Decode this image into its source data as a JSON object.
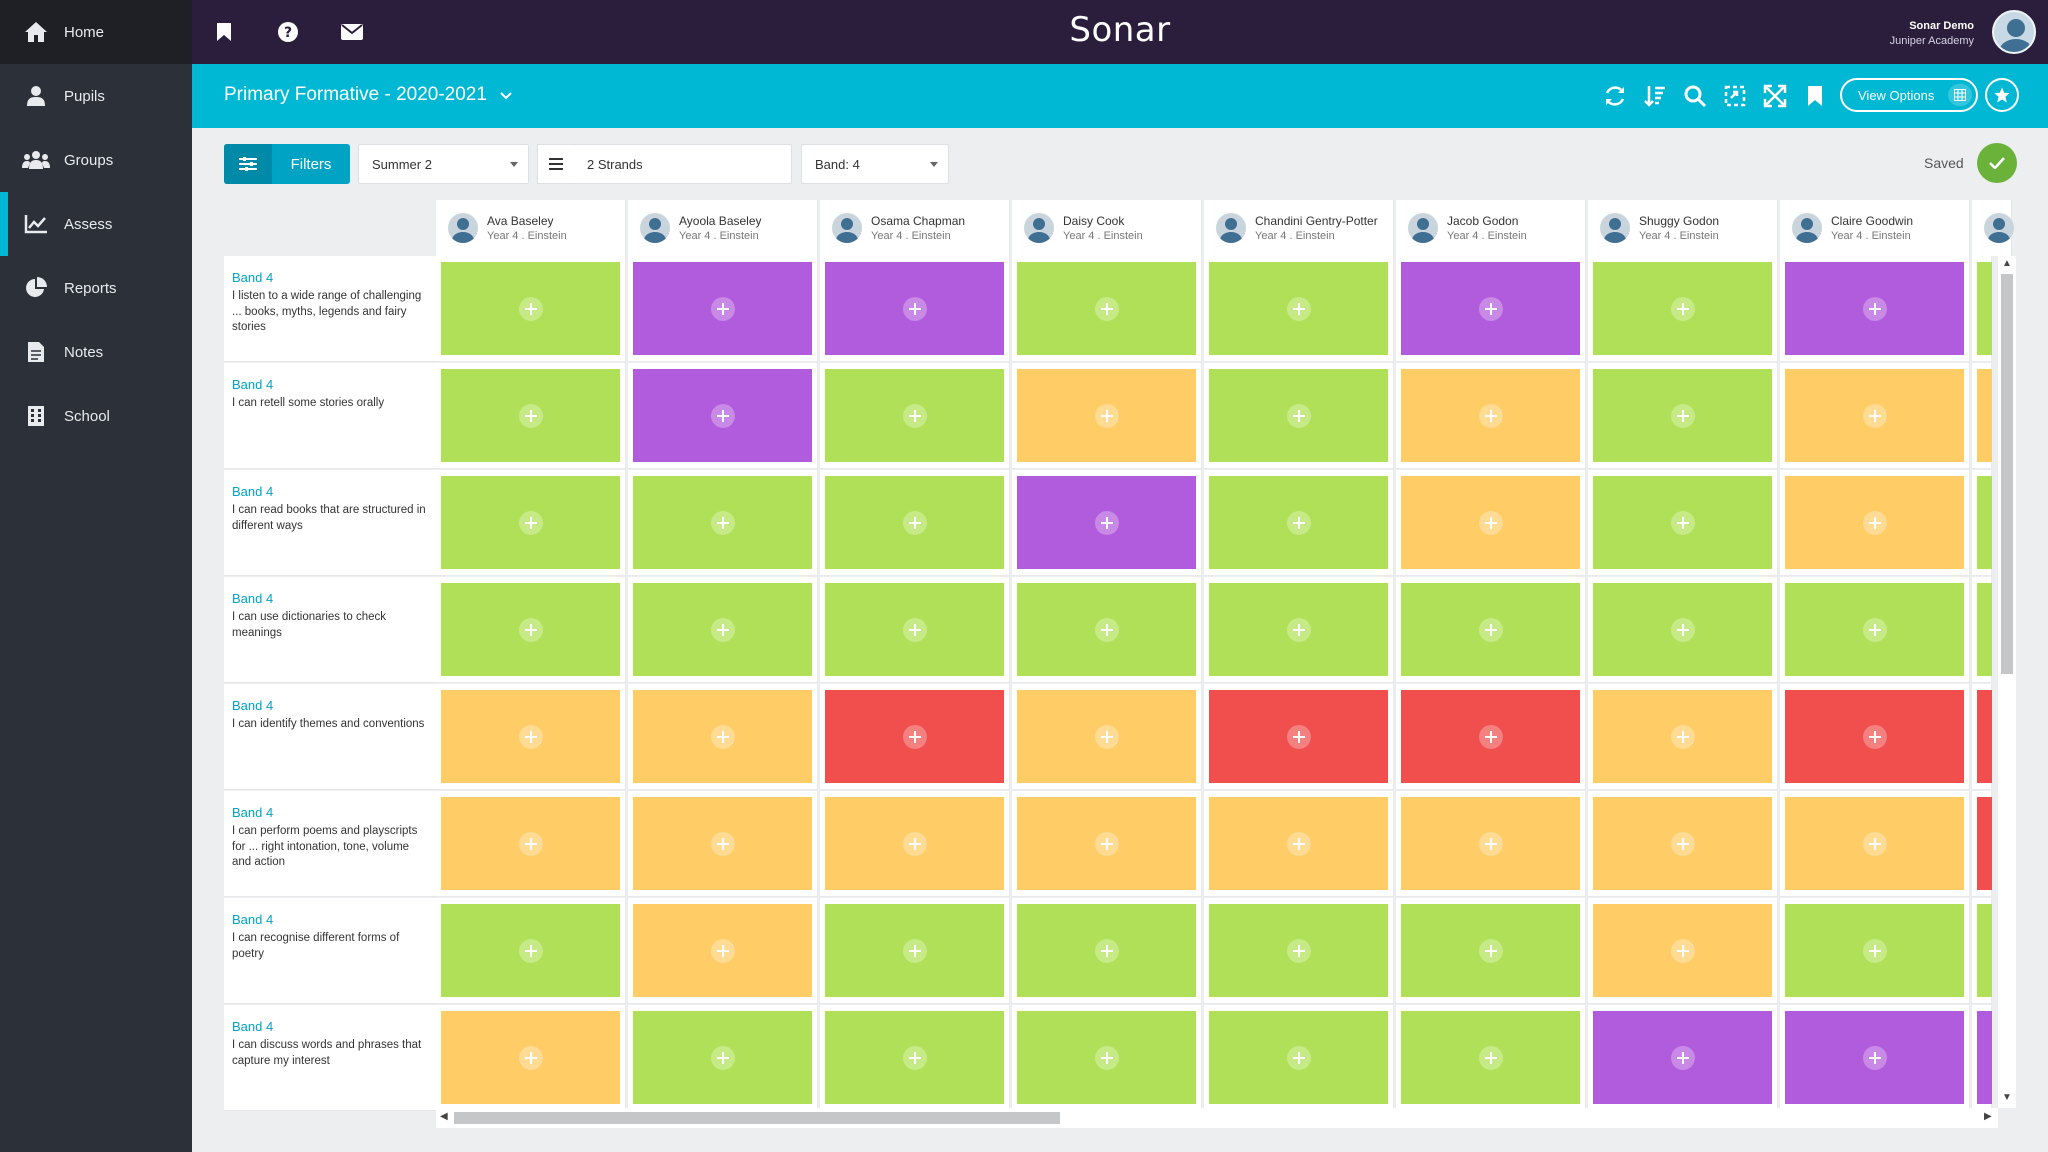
{
  "sidebar": {
    "items": [
      {
        "label": "Home",
        "icon": "home-icon"
      },
      {
        "label": "Pupils",
        "icon": "person-icon"
      },
      {
        "label": "Groups",
        "icon": "people-icon"
      },
      {
        "label": "Assess",
        "icon": "chart-line-icon"
      },
      {
        "label": "Reports",
        "icon": "pie-chart-icon"
      },
      {
        "label": "Notes",
        "icon": "document-icon"
      },
      {
        "label": "School",
        "icon": "building-icon"
      }
    ],
    "active": "Assess"
  },
  "header": {
    "logo": "Sonar",
    "user_name": "Sonar Demo",
    "user_school": "Juniper Academy"
  },
  "titlebar": {
    "title": "Primary Formative - 2020-2021",
    "view_options": "View Options"
  },
  "filters": {
    "filters_label": "Filters",
    "term": "Summer 2",
    "strands": "2 Strands",
    "band": "Band: 4",
    "saved_label": "Saved"
  },
  "colors": {
    "green": "#b0e057",
    "purple": "#b05cdc",
    "orange": "#ffcc66",
    "red": "#f14e4e",
    "accent": "#00b8d4"
  },
  "pupils": [
    {
      "name": "Ava Baseley",
      "meta": "Year 4 . Einstein"
    },
    {
      "name": "Ayoola Baseley",
      "meta": "Year 4 . Einstein"
    },
    {
      "name": "Osama Chapman",
      "meta": "Year 4 . Einstein"
    },
    {
      "name": "Daisy Cook",
      "meta": "Year 4 . Einstein"
    },
    {
      "name": "Chandini Gentry-Potter",
      "meta": "Year 4 . Einstein"
    },
    {
      "name": "Jacob Godon",
      "meta": "Year 4 . Einstein"
    },
    {
      "name": "Shuggy Godon",
      "meta": "Year 4 . Einstein"
    },
    {
      "name": "Claire Goodwin",
      "meta": "Year 4 . Einstein"
    }
  ],
  "rows": [
    {
      "band": "Band 4",
      "text": "I listen to a wide range of challenging ... books, myths, legends and fairy stories",
      "cells": [
        "green",
        "purple",
        "purple",
        "green",
        "green",
        "purple",
        "green",
        "purple",
        "green"
      ]
    },
    {
      "band": "Band 4",
      "text": "I can retell some stories orally",
      "cells": [
        "green",
        "purple",
        "green",
        "orange",
        "green",
        "orange",
        "green",
        "orange",
        "orange"
      ]
    },
    {
      "band": "Band 4",
      "text": "I can read books that are structured in different ways",
      "cells": [
        "green",
        "green",
        "green",
        "purple",
        "green",
        "orange",
        "green",
        "orange",
        "green"
      ]
    },
    {
      "band": "Band 4",
      "text": "I can use dictionaries to check meanings",
      "cells": [
        "green",
        "green",
        "green",
        "green",
        "green",
        "green",
        "green",
        "green",
        "green"
      ]
    },
    {
      "band": "Band 4",
      "text": "I can identify themes and conventions",
      "cells": [
        "orange",
        "orange",
        "red",
        "orange",
        "red",
        "red",
        "orange",
        "red",
        "red"
      ]
    },
    {
      "band": "Band 4",
      "text": "I can perform poems and playscripts for ... right intonation, tone, volume and action",
      "cells": [
        "orange",
        "orange",
        "orange",
        "orange",
        "orange",
        "orange",
        "orange",
        "orange",
        "red"
      ]
    },
    {
      "band": "Band 4",
      "text": "I can recognise different forms of poetry",
      "cells": [
        "green",
        "orange",
        "green",
        "green",
        "green",
        "green",
        "orange",
        "green",
        "green"
      ]
    },
    {
      "band": "Band 4",
      "text": "I can discuss words and phrases that capture my interest",
      "cells": [
        "orange",
        "green",
        "green",
        "green",
        "green",
        "green",
        "purple",
        "purple",
        "purple"
      ]
    }
  ]
}
